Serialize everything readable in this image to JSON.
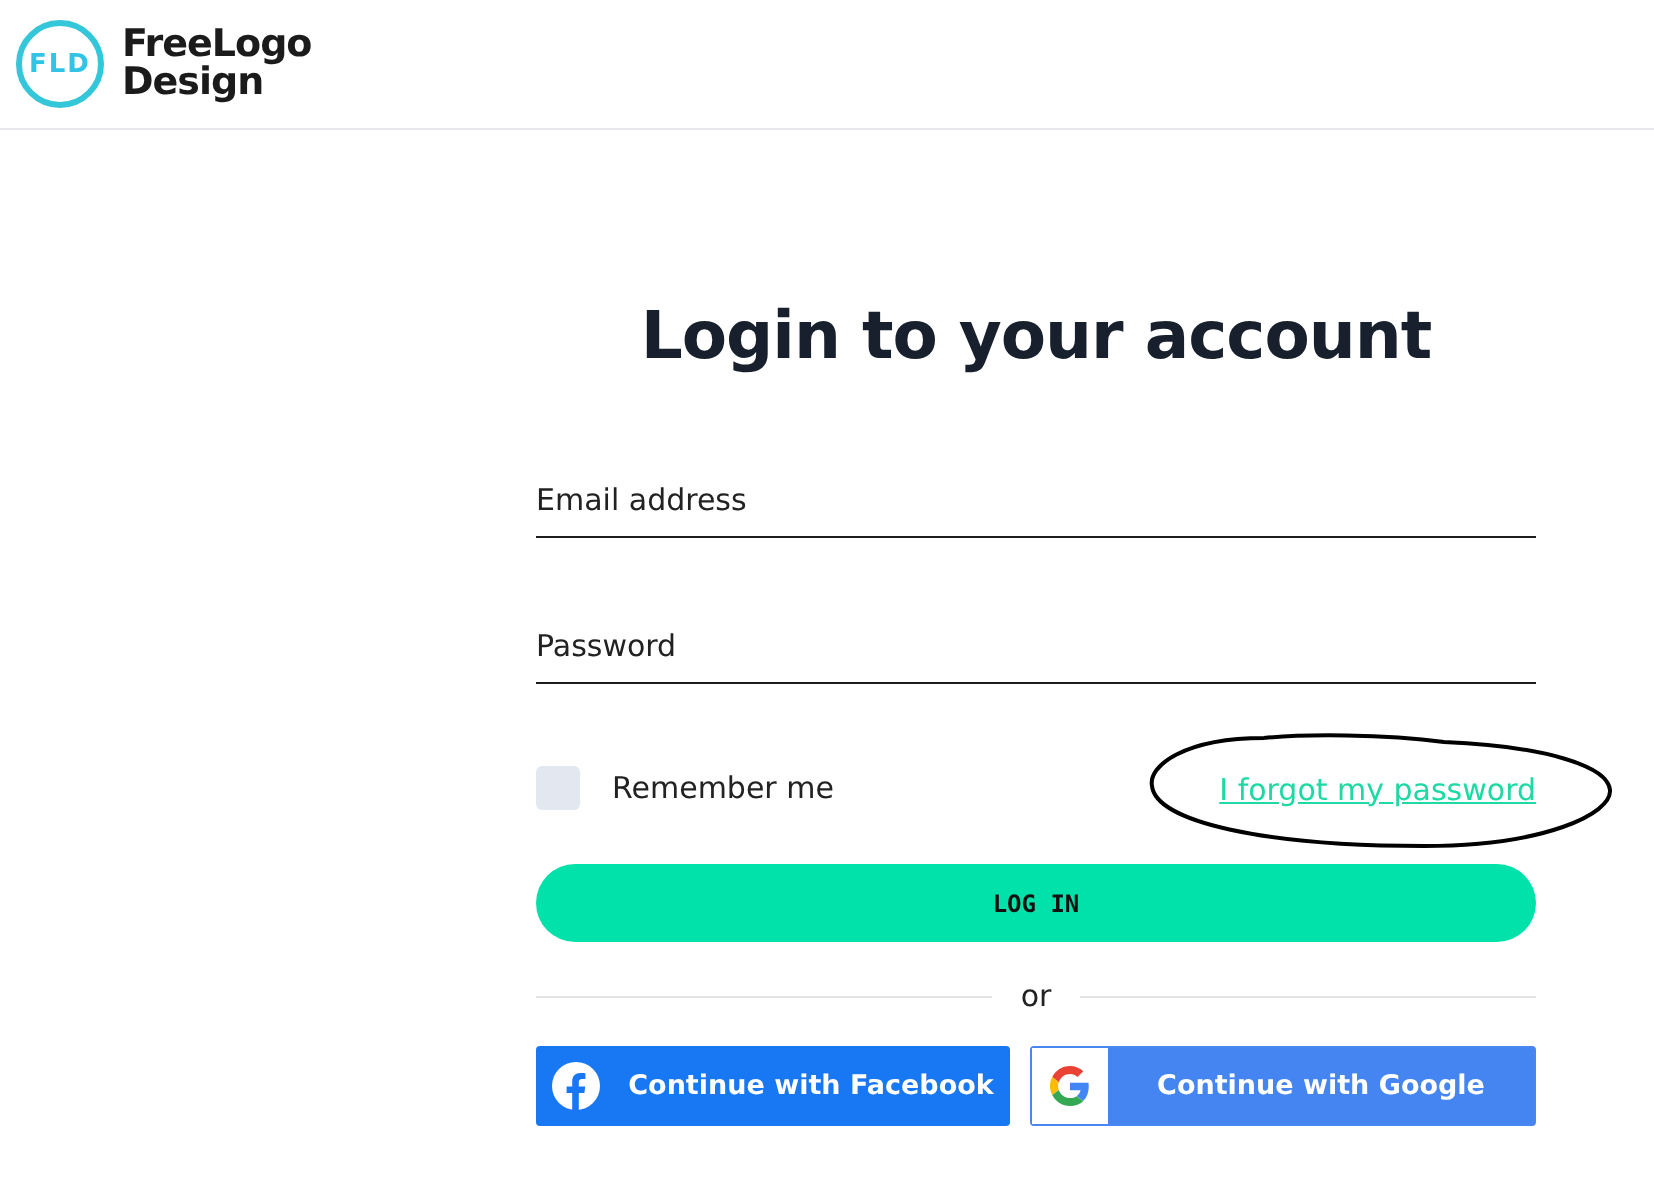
{
  "logo": {
    "mark": "FLD",
    "lines": [
      "FreeLogo",
      "Design"
    ]
  },
  "title": "Login to your account",
  "fields": [
    {
      "placeholder": "Email address"
    },
    {
      "placeholder": "Password"
    }
  ],
  "remember": {
    "label": "Remember me",
    "checked": false
  },
  "forgot_link": "I forgot my password",
  "login_button": "LOG IN",
  "divider": "or",
  "social_buttons": [
    {
      "label": "Continue with Facebook",
      "kind": "facebook"
    },
    {
      "label": "Continue with Google",
      "kind": "google"
    }
  ]
}
